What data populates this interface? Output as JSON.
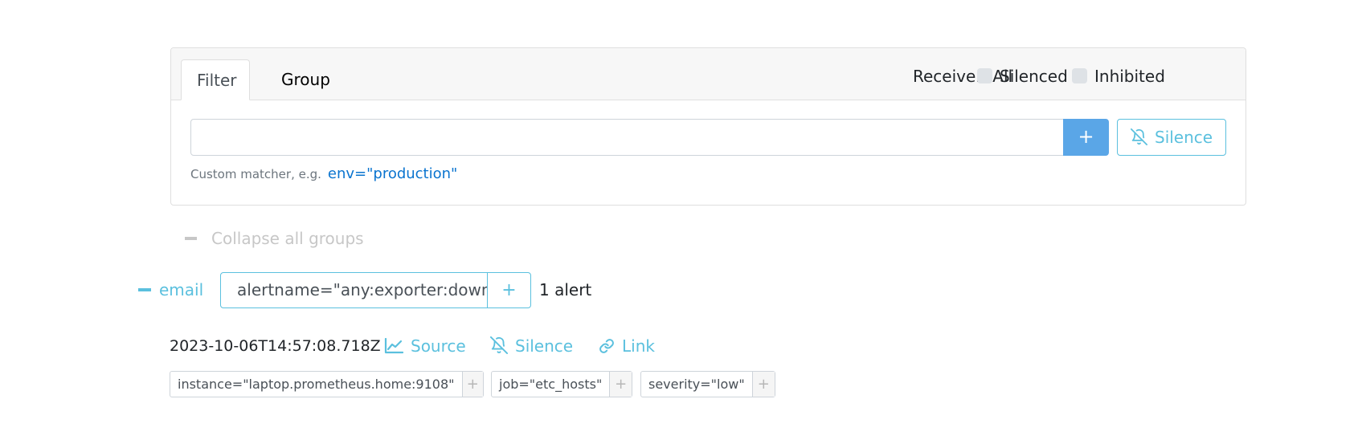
{
  "filter_bar": {
    "tabs": [
      {
        "label": "Filter",
        "active": true
      },
      {
        "label": "Group",
        "active": false
      }
    ],
    "receiver_label": "Receiver: All",
    "silenced_label": "Silenced",
    "inhibited_label": "Inhibited",
    "input_value": "",
    "add_button_label": "+",
    "silence_button_label": "Silence",
    "hint_text": "Custom matcher, e.g.",
    "hint_example": "env=\"production\""
  },
  "collapse_all_label": "Collapse all groups",
  "group": {
    "receiver": "email",
    "matcher": "alertname=\"any:exporter:down\"",
    "matcher_add": "+",
    "alert_count": "1 alert"
  },
  "alert": {
    "timestamp": "2023-10-06T14:57:08.718Z",
    "actions": {
      "source": "Source",
      "silence": "Silence",
      "link": "Link"
    },
    "labels": [
      {
        "text": "instance=\"laptop.prometheus.home:9108\"",
        "add": "+"
      },
      {
        "text": "job=\"etc_hosts\"",
        "add": "+"
      },
      {
        "text": "severity=\"low\"",
        "add": "+"
      }
    ]
  },
  "colors": {
    "accent": "#5bc0de",
    "primary_button": "#5aa6e7",
    "link": "#0a74cf",
    "muted": "#c7c7c7"
  },
  "icons": [
    "bell-slash-icon",
    "chart-line-icon",
    "link-icon",
    "minus-icon"
  ]
}
